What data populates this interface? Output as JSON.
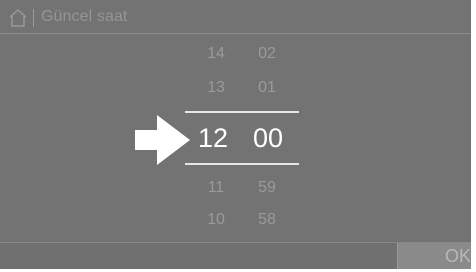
{
  "header": {
    "title": "Güncel saat",
    "home_icon": "home-icon"
  },
  "time_picker": {
    "hours": {
      "above": [
        "14",
        "13"
      ],
      "selected": "12",
      "below": [
        "11",
        "10"
      ]
    },
    "minutes": {
      "above": [
        "02",
        "01"
      ],
      "selected": "00",
      "below": [
        "59",
        "58"
      ]
    },
    "pointer_icon": "arrow-right-icon"
  },
  "footer": {
    "ok_label": "OK"
  },
  "colors": {
    "background": "#737373",
    "selected_text": "#ffffff",
    "dim_text": "#9a9a9a"
  }
}
